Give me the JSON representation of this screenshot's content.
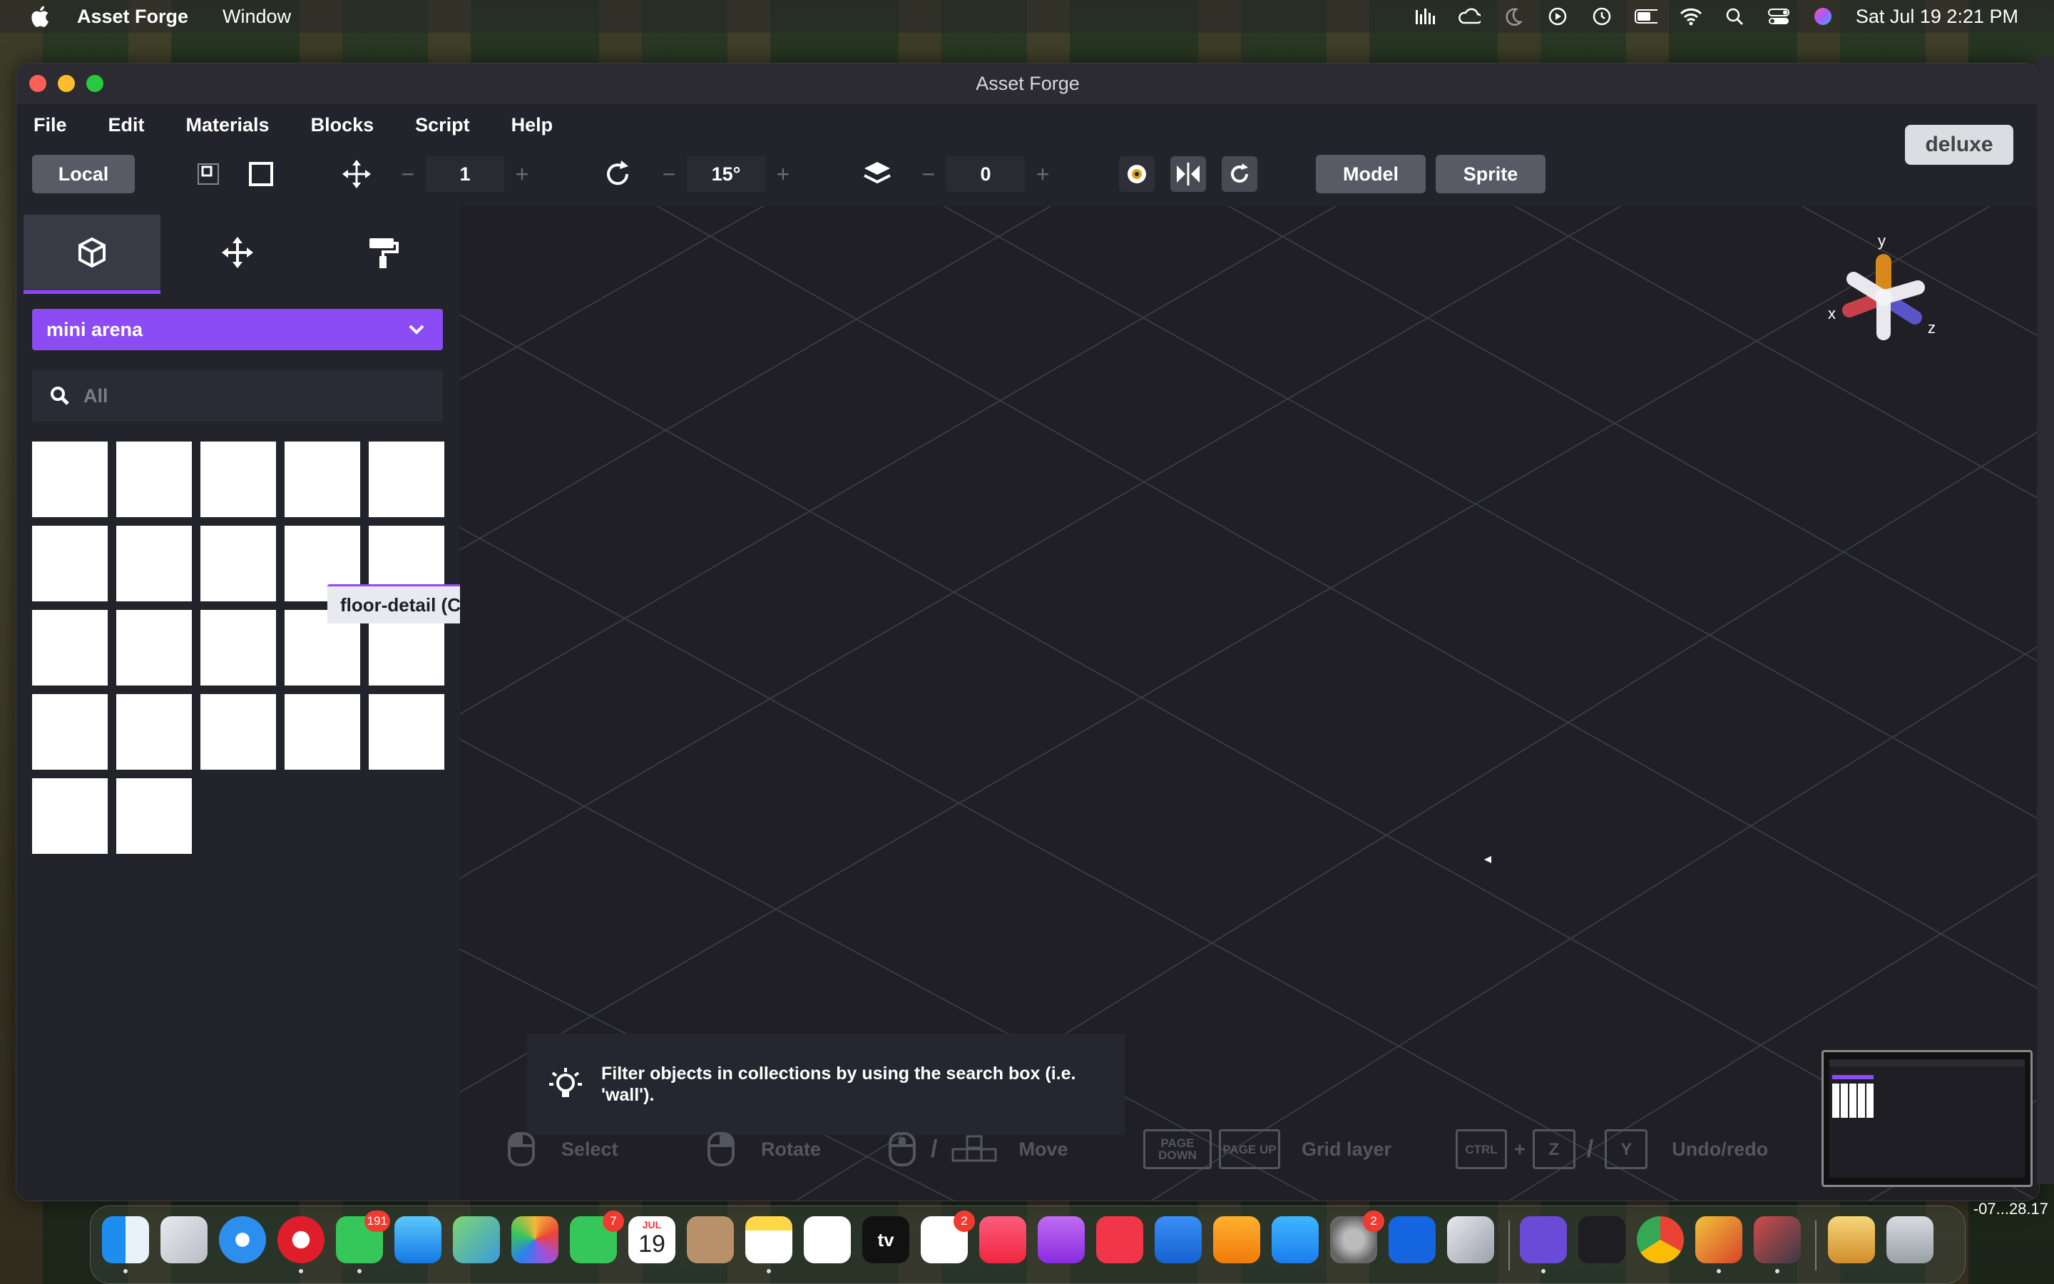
{
  "menubar": {
    "app_name": "Asset Forge",
    "menus": [
      "Window"
    ],
    "clock": "Sat Jul 19  2:21 PM"
  },
  "window": {
    "title": "Asset Forge",
    "app_menus": [
      "File",
      "Edit",
      "Materials",
      "Blocks",
      "Script",
      "Help"
    ],
    "badge": "deluxe"
  },
  "toolbar": {
    "space_button": "Local",
    "move_step": "1",
    "rotate_step": "15°",
    "grid_layer": "0",
    "model_button": "Model",
    "sprite_button": "Sprite"
  },
  "sidebar": {
    "tabs": [
      "blocks-tab",
      "transform-tab",
      "paint-tab"
    ],
    "collection": "mini arena",
    "search_placeholder": "All",
    "tile_count": 22,
    "tooltip": "floor-detail (Custom)"
  },
  "viewport": {
    "gizmo_labels": {
      "x": "x",
      "y": "y",
      "z": "z"
    },
    "hint": "Filter objects in collections by using the search box (i.e. 'wall').",
    "controls": {
      "select": "Select",
      "rotate": "Rotate",
      "move_sep": "/",
      "move": "Move",
      "page_down": "PAGE DOWN",
      "page_up": "PAGE UP",
      "grid_layer": "Grid layer",
      "ctrl": "CTRL",
      "plus": "+",
      "z": "Z",
      "slash": "/",
      "y": "Y",
      "undo_redo": "Undo/redo"
    }
  },
  "dock": {
    "messages_badge": "191",
    "facetime_badge": "7",
    "calendar_month": "JUL",
    "calendar_day": "19",
    "reminders_badge": "2",
    "settings_badge": "2",
    "appletv_label": "tv",
    "edge_text": "-07...28.17"
  },
  "colors": {
    "accent": "#8b4cf4",
    "viewport_bg": "#1f1f25"
  }
}
